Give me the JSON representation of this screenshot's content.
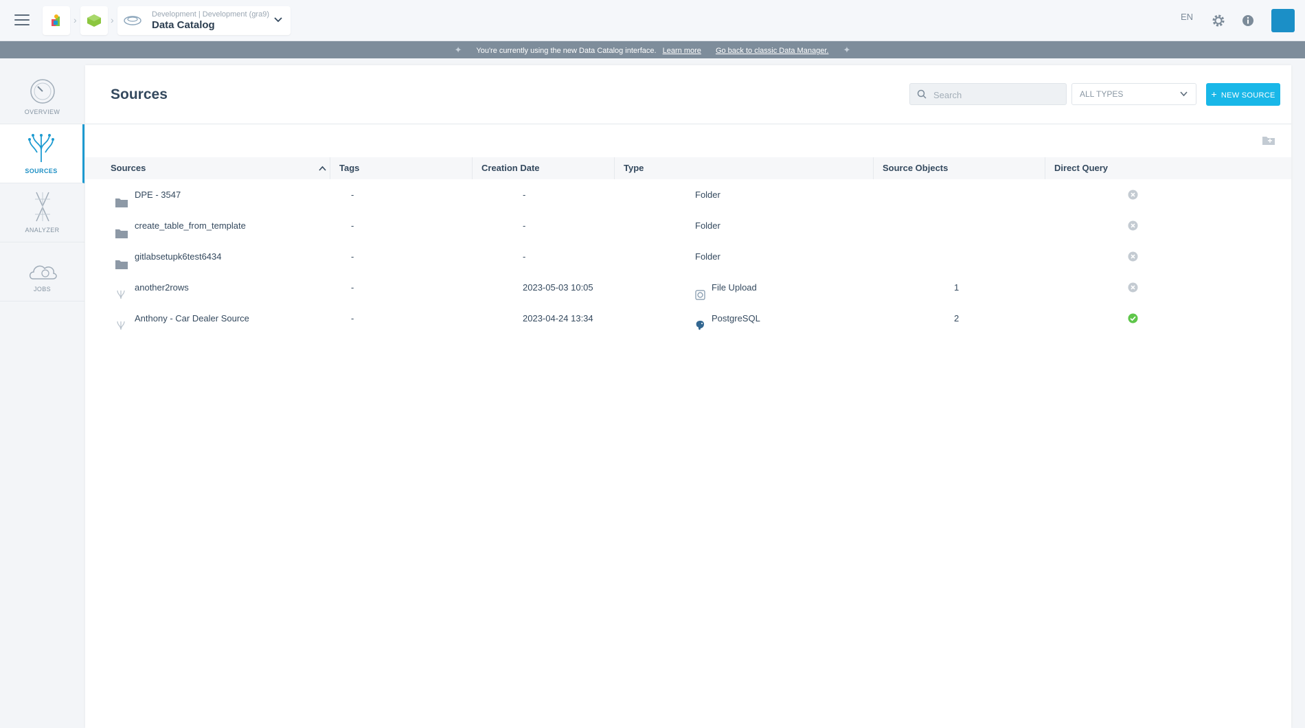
{
  "topbar": {
    "menu_icon": "hamburger-icon",
    "breadcrumb": {
      "project_icon": "colorful-project-icon",
      "app_icon": "green-cube-icon",
      "catalog_icon": "data-catalog-icon",
      "subtitle": "Development | Development (gra9)",
      "title": "Data Catalog"
    },
    "language": "EN",
    "settings_icon": "gear-icon",
    "info_icon": "info-icon",
    "avatar_color": "#1b8fc7"
  },
  "banner": {
    "text": "You're currently using the new Data Catalog interface.",
    "learn_more": "Learn more",
    "classic_link": "Go back to classic Data Manager."
  },
  "sidebar": {
    "items": [
      {
        "label": "OVERVIEW",
        "icon": "gauge-icon",
        "active": false
      },
      {
        "label": "SOURCES",
        "icon": "sources-tree-icon",
        "active": true
      },
      {
        "label": "ANALYZER",
        "icon": "analyzer-icon",
        "active": false
      },
      {
        "label": "JOBS",
        "icon": "jobs-cloud-icon",
        "active": false
      }
    ]
  },
  "main": {
    "title": "Sources",
    "search": {
      "placeholder": "Search",
      "value": ""
    },
    "type_filter": "ALL TYPES",
    "new_button": "NEW SOURCE",
    "accent": "#19b7e8"
  },
  "table": {
    "headers": {
      "sources": "Sources",
      "tags": "Tags",
      "creation_date": "Creation Date",
      "type": "Type",
      "source_objects": "Source Objects",
      "direct_query": "Direct Query"
    },
    "rows": [
      {
        "name": "DPE - 3547",
        "name_icon": "folder-icon",
        "tags": "-",
        "date": "-",
        "type": "Folder",
        "type_icon": "",
        "objects": "",
        "direct_query": false
      },
      {
        "name": "create_table_from_template",
        "name_icon": "folder-icon",
        "tags": "-",
        "date": "-",
        "type": "Folder",
        "type_icon": "",
        "objects": "",
        "direct_query": false
      },
      {
        "name": "gitlabsetupk6test6434",
        "name_icon": "folder-icon",
        "tags": "-",
        "date": "-",
        "type": "Folder",
        "type_icon": "",
        "objects": "",
        "direct_query": false
      },
      {
        "name": "another2rows",
        "name_icon": "source-icon",
        "tags": "-",
        "date": "2023-05-03 10:05",
        "type": "File Upload",
        "type_icon": "file-upload-icon",
        "objects": "1",
        "direct_query": false
      },
      {
        "name": "Anthony - Car Dealer Source",
        "name_icon": "source-icon",
        "tags": "-",
        "date": "2023-04-24 13:34",
        "type": "PostgreSQL",
        "type_icon": "postgresql-icon",
        "objects": "2",
        "direct_query": true
      }
    ]
  }
}
